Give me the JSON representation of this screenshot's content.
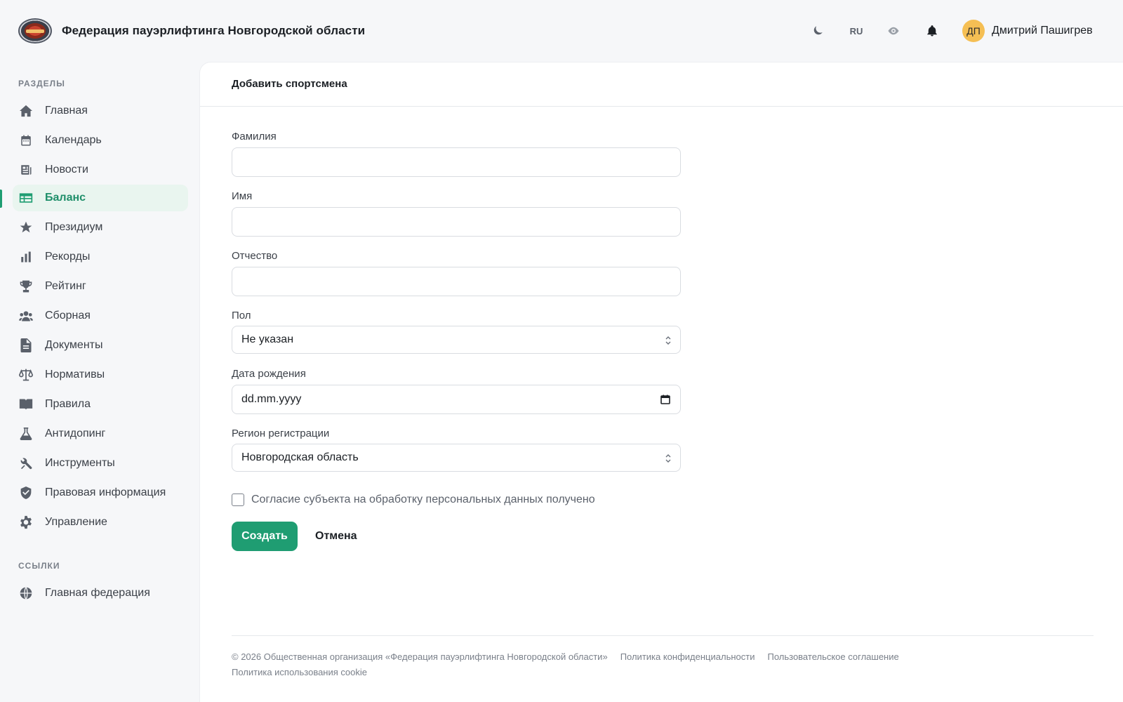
{
  "header": {
    "logo_icon": "federation-logo",
    "title": "Федерация пауэрлифтинга Новгородской области",
    "theme_icon": "moon-icon",
    "lang": "RU",
    "accessibility_icon": "eye-icon",
    "notifications_icon": "bell-icon",
    "user": {
      "initials": "ДП",
      "name": "Дмитрий Пашигрев",
      "avatar_color": "#f5bf54"
    }
  },
  "sidebar": {
    "sections_title": "РАЗДЕЛЫ",
    "items": [
      {
        "label": "Главная",
        "icon": "home-icon"
      },
      {
        "label": "Календарь",
        "icon": "calendar-icon"
      },
      {
        "label": "Новости",
        "icon": "newspaper-icon"
      },
      {
        "label": "Баланс",
        "icon": "table-icon",
        "active": true
      },
      {
        "label": "Президиум",
        "icon": "star-icon"
      },
      {
        "label": "Рекорды",
        "icon": "bar-chart-icon"
      },
      {
        "label": "Рейтинг",
        "icon": "trophy-icon"
      },
      {
        "label": "Сборная",
        "icon": "team-icon"
      },
      {
        "label": "Документы",
        "icon": "document-icon"
      },
      {
        "label": "Нормативы",
        "icon": "scales-icon"
      },
      {
        "label": "Правила",
        "icon": "book-icon"
      },
      {
        "label": "Антидопинг",
        "icon": "flask-icon"
      },
      {
        "label": "Инструменты",
        "icon": "tools-icon"
      },
      {
        "label": "Правовая информация",
        "icon": "shield-icon"
      },
      {
        "label": "Управление",
        "icon": "gear-icon"
      }
    ],
    "links_title": "ССЫЛКИ",
    "links": [
      {
        "label": "Главная федерация",
        "icon": "globe-icon"
      }
    ]
  },
  "form": {
    "title": "Добавить спортсмена",
    "last_name": {
      "label": "Фамилия",
      "value": ""
    },
    "first_name": {
      "label": "Имя",
      "value": ""
    },
    "patronymic": {
      "label": "Отчество",
      "value": ""
    },
    "gender": {
      "label": "Пол",
      "value": "Не указан"
    },
    "birth_date": {
      "label": "Дата рождения",
      "placeholder": "dd.mm.yyyy"
    },
    "region": {
      "label": "Регион регистрации",
      "value": "Новгородская область"
    },
    "consent": {
      "label": "Согласие субъекта на обработку персональных данных получено",
      "checked": false
    },
    "submit_label": "Создать",
    "cancel_label": "Отмена"
  },
  "footer": {
    "copyright": "© 2026 Общественная организация «Федерация пауэрлифтинга Новгородской области»",
    "privacy": "Политика конфиденциальности",
    "terms": "Пользовательское соглашение",
    "cookie": "Политика использования cookie"
  },
  "colors": {
    "accent": "#1f9d72",
    "active_bg": "#e9f5ef",
    "background": "#f6f7f9"
  }
}
